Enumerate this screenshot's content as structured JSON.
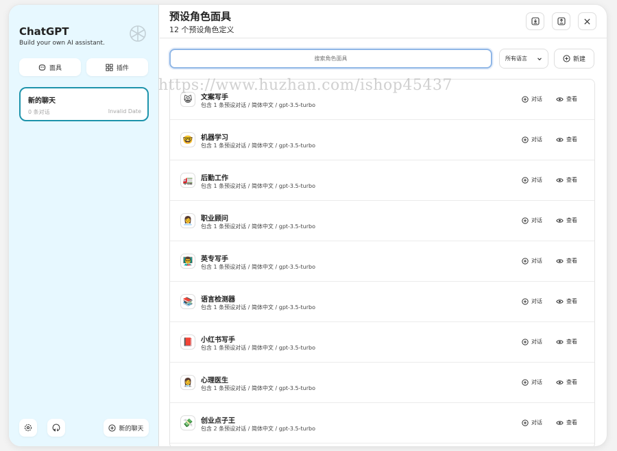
{
  "sidebar": {
    "title": "ChatGPT",
    "subtitle": "Build your own AI assistant.",
    "mask_button": "面具",
    "plugin_button": "插件",
    "chats": [
      {
        "title": "新的聊天",
        "count": "0 条对话",
        "date": "Invalid Date"
      }
    ],
    "new_chat_button": "新的聊天"
  },
  "header": {
    "title": "预设角色面具",
    "subtitle": "12 个预设角色定义"
  },
  "toolbar": {
    "search_placeholder": "搜索角色面具",
    "language_selected": "所有语言",
    "new_button": "新建"
  },
  "masks": [
    {
      "icon": "😸",
      "name": "文案写手",
      "info": "包含 1 条预设对话 / 简体中文 / gpt-3.5-turbo"
    },
    {
      "icon": "🤓",
      "name": "机器学习",
      "info": "包含 1 条预设对话 / 简体中文 / gpt-3.5-turbo"
    },
    {
      "icon": "🚛",
      "name": "后勤工作",
      "info": "包含 1 条预设对话 / 简体中文 / gpt-3.5-turbo"
    },
    {
      "icon": "👩‍💼",
      "name": "职业顾问",
      "info": "包含 1 条预设对话 / 简体中文 / gpt-3.5-turbo"
    },
    {
      "icon": "👨‍🏫",
      "name": "英专写手",
      "info": "包含 1 条预设对话 / 简体中文 / gpt-3.5-turbo"
    },
    {
      "icon": "📚",
      "name": "语言检测器",
      "info": "包含 1 条预设对话 / 简体中文 / gpt-3.5-turbo"
    },
    {
      "icon": "📕",
      "name": "小红书写手",
      "info": "包含 1 条预设对话 / 简体中文 / gpt-3.5-turbo"
    },
    {
      "icon": "👩‍⚕️",
      "name": "心理医生",
      "info": "包含 1 条预设对话 / 简体中文 / gpt-3.5-turbo"
    },
    {
      "icon": "💸",
      "name": "创业点子王",
      "info": "包含 2 条预设对话 / 简体中文 / gpt-3.5-turbo"
    }
  ],
  "actions": {
    "chat": "对话",
    "view": "查看"
  },
  "watermark": "https://www.huzhan.com/ishop45437",
  "colors": {
    "sidebar_bg": "#e7f8ff",
    "accent": "#1d93ab",
    "search_border": "#8fb6e6"
  }
}
